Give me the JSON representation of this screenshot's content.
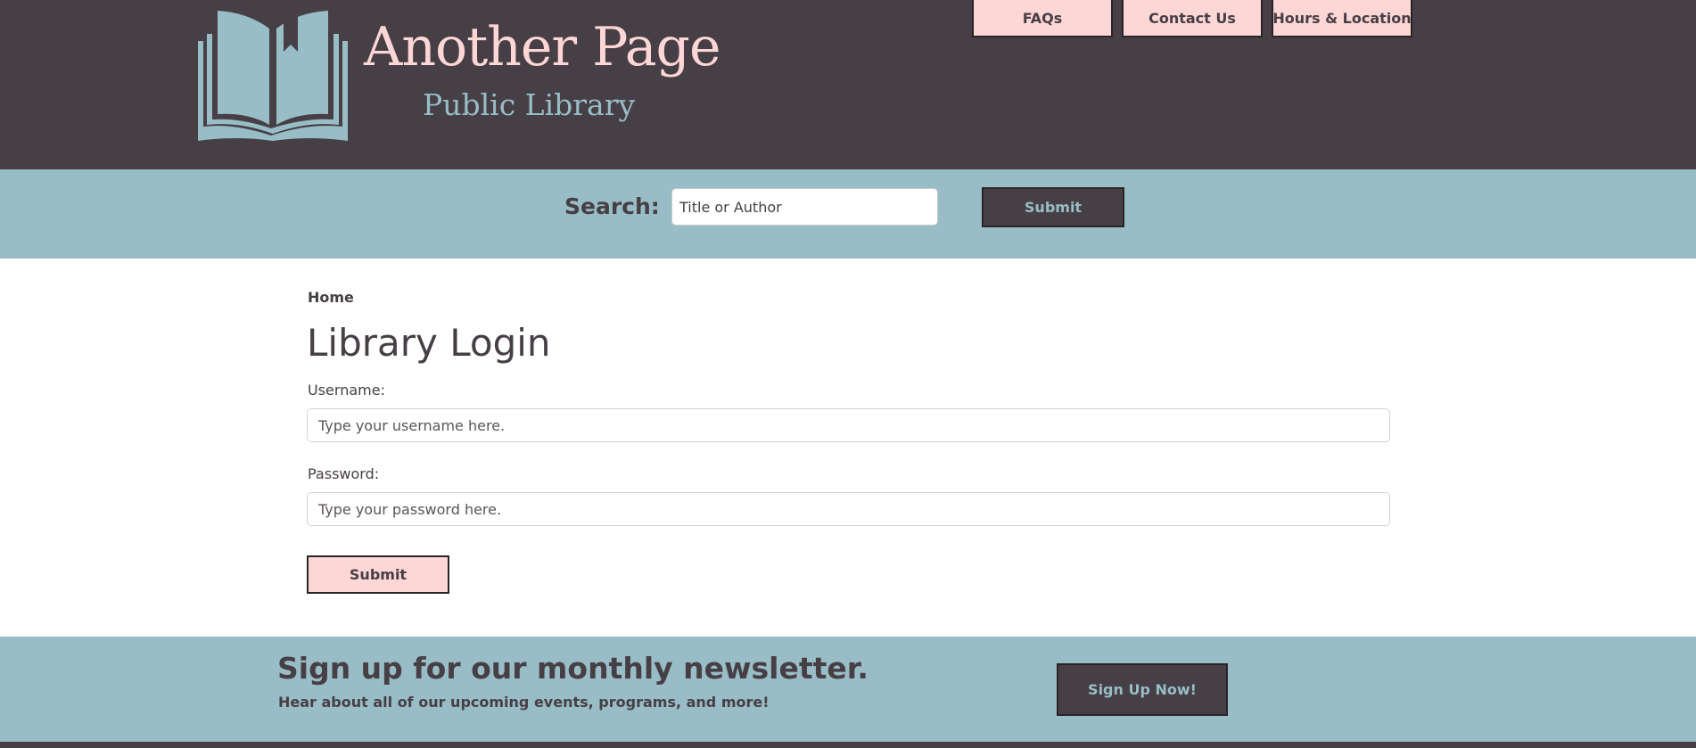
{
  "header": {
    "logo_title": "Another Page",
    "logo_subtitle": "Public Library",
    "logo_icon": "open-book-icon",
    "nav": [
      "FAQs",
      "Contact Us",
      "Hours & Location"
    ]
  },
  "search": {
    "label": "Search:",
    "placeholder": "Title or Author",
    "submit_label": "Submit"
  },
  "breadcrumb": "Home",
  "login": {
    "title": "Library Login",
    "username_label": "Username:",
    "username_placeholder": "Type your username here.",
    "password_label": "Password:",
    "password_placeholder": "Type your password here.",
    "submit_label": "Submit"
  },
  "newsletter": {
    "title": "Sign up for our monthly newsletter.",
    "subtitle": "Hear about all of our upcoming events, programs, and more!",
    "button_label": "Sign Up Now!"
  },
  "colors": {
    "dark": "#463f45",
    "pink": "#ffd6d6",
    "blue": "#99bdc6"
  }
}
